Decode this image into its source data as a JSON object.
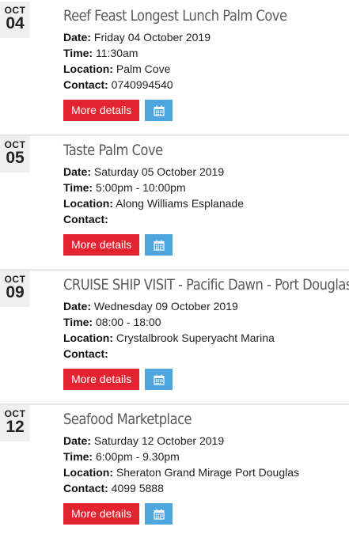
{
  "labels": {
    "date": "Date:",
    "time": "Time:",
    "location": "Location:",
    "contact": "Contact:",
    "more_details": "More details"
  },
  "events": [
    {
      "month": "OCT",
      "day": "04",
      "title": "Reef Feast Longest Lunch Palm Cove",
      "date": "Friday 04 October 2019",
      "time": "11:30am",
      "location": "Palm Cove",
      "contact": "0740994540"
    },
    {
      "month": "OCT",
      "day": "05",
      "title": "Taste Palm Cove",
      "date": "Saturday 05 October 2019",
      "time": "5:00pm - 10:00pm",
      "location": "Along Williams Esplanade",
      "contact": ""
    },
    {
      "month": "OCT",
      "day": "09",
      "title": "CRUISE SHIP VISIT - Pacific Dawn - Port Douglas",
      "date": "Wednesday 09 October 2019",
      "time": "08:00 - 18:00",
      "location": "Crystalbrook Superyacht Marina",
      "contact": ""
    },
    {
      "month": "OCT",
      "day": "12",
      "title": "Seafood Marketplace",
      "date": "Saturday 12 October 2019",
      "time": "6:00pm - 9.30pm",
      "location": "Sheraton Grand Mirage Port Douglas",
      "contact": "4099 5888"
    }
  ],
  "colors": {
    "more_button": "#e3232f",
    "calendar_button": "#4fa6df",
    "date_box": "#efefef",
    "title": "#5a5a5a"
  },
  "icons": {
    "calendar_button": "calendar-icon"
  }
}
